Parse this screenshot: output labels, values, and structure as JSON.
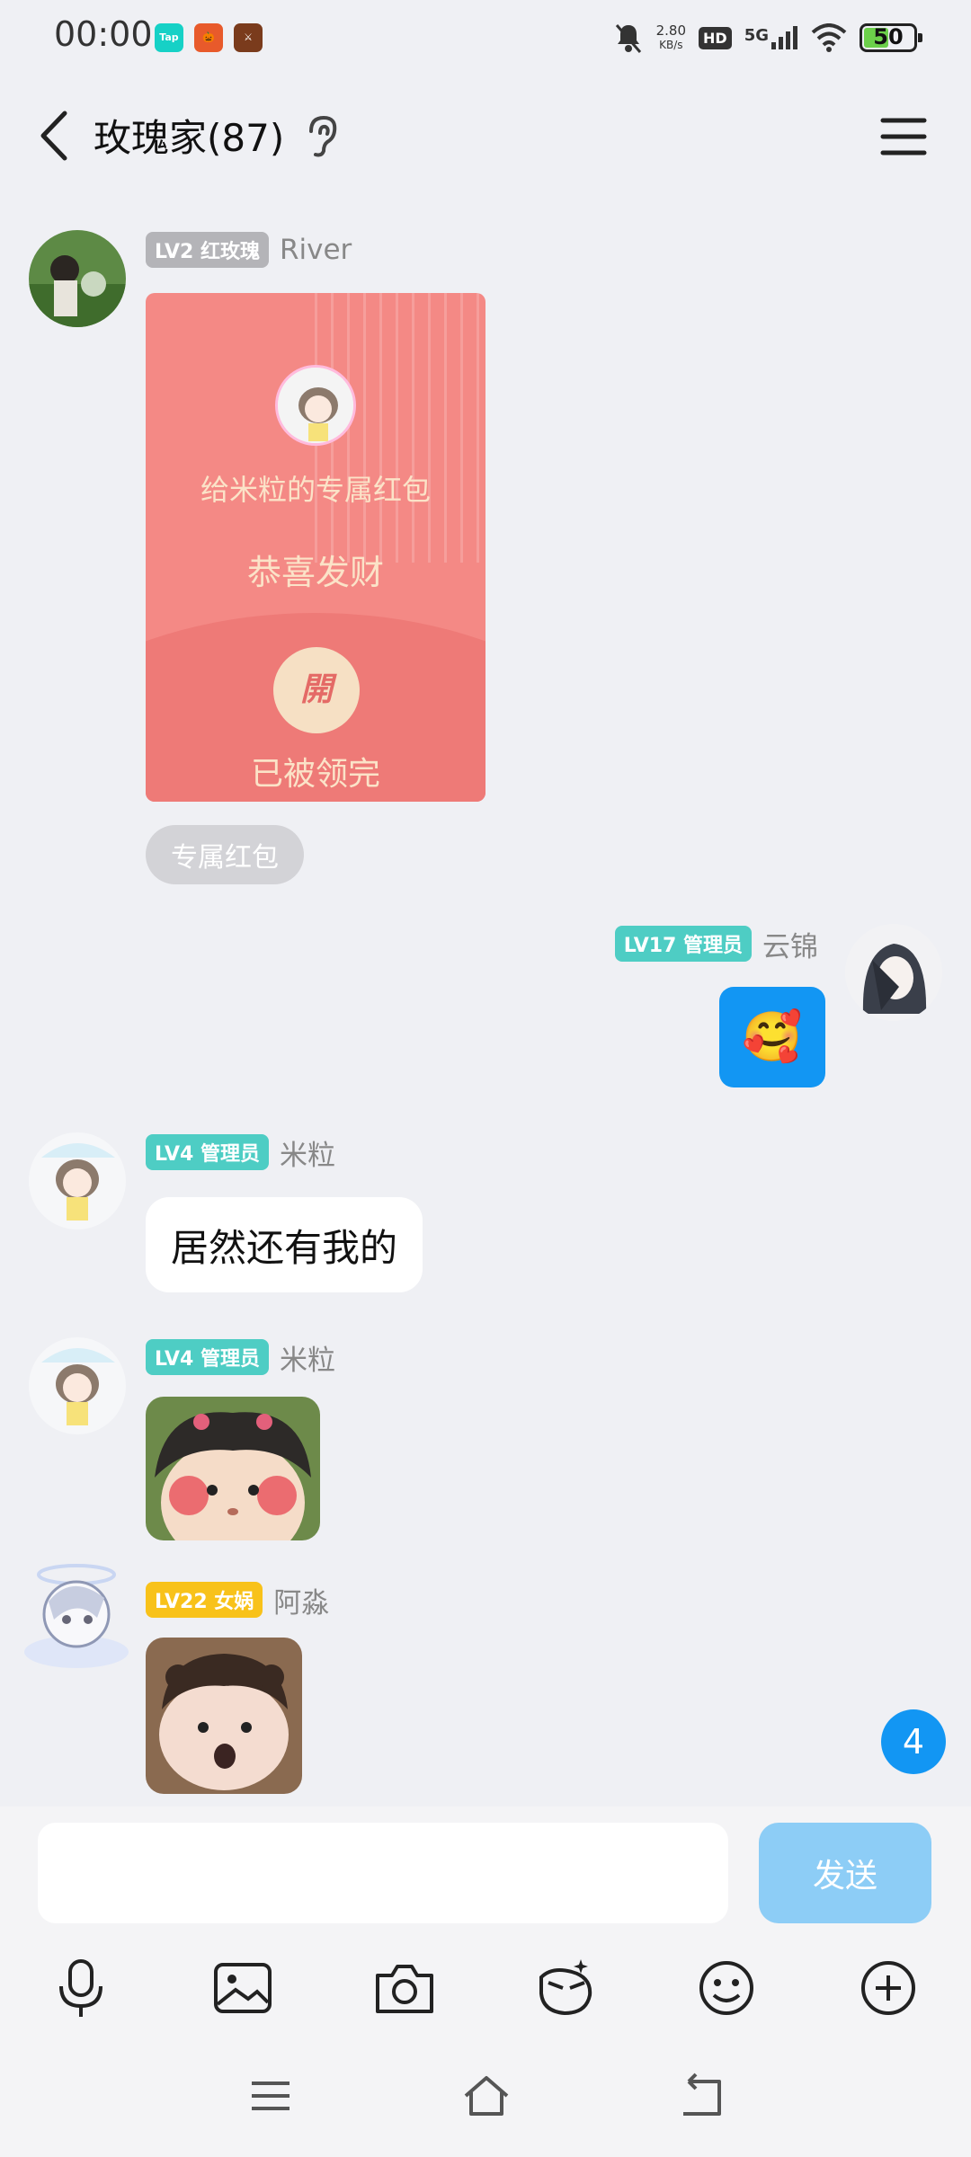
{
  "status_bar": {
    "time": "00:00",
    "net_speed_value": "2.80",
    "net_speed_unit": "KB/s",
    "hd": "HD",
    "signal": "5G",
    "battery": "50",
    "battery_level": 0.5,
    "app_icons": [
      "taptap-icon",
      "pumpkin-game-icon",
      "game-icon"
    ]
  },
  "header": {
    "title": "玫瑰家(87)"
  },
  "messages": [
    {
      "badge": "LV2 红玫瑰",
      "nick": "River",
      "red_packet": {
        "title": "给米粒的专属红包",
        "wish": "恭喜发财",
        "open_label": "開",
        "status": "已被领完"
      },
      "tag": "专属红包"
    },
    {
      "badge": "LV17 管理员",
      "nick": "云锦",
      "emoji": "🥰"
    },
    {
      "badge": "LV4 管理员",
      "nick": "米粒",
      "text": "居然还有我的"
    },
    {
      "badge": "LV4 管理员",
      "nick": "米粒",
      "sticker": "girl-blush-sticker"
    },
    {
      "badge": "LV22 女娲",
      "nick": "阿淼",
      "sticker": "boy-shocked-sticker"
    }
  ],
  "unread_count": "4",
  "composer": {
    "placeholder": "",
    "send_label": "发送"
  },
  "toolbar": [
    "microphone-icon",
    "image-icon",
    "camera-icon",
    "sticker-icon",
    "emoji-icon",
    "plus-icon"
  ],
  "colors": {
    "accent": "#1296f3",
    "badge_teal": "#4ecdc4",
    "badge_gold": "#f8c21a",
    "red_packet": "#f48985"
  }
}
